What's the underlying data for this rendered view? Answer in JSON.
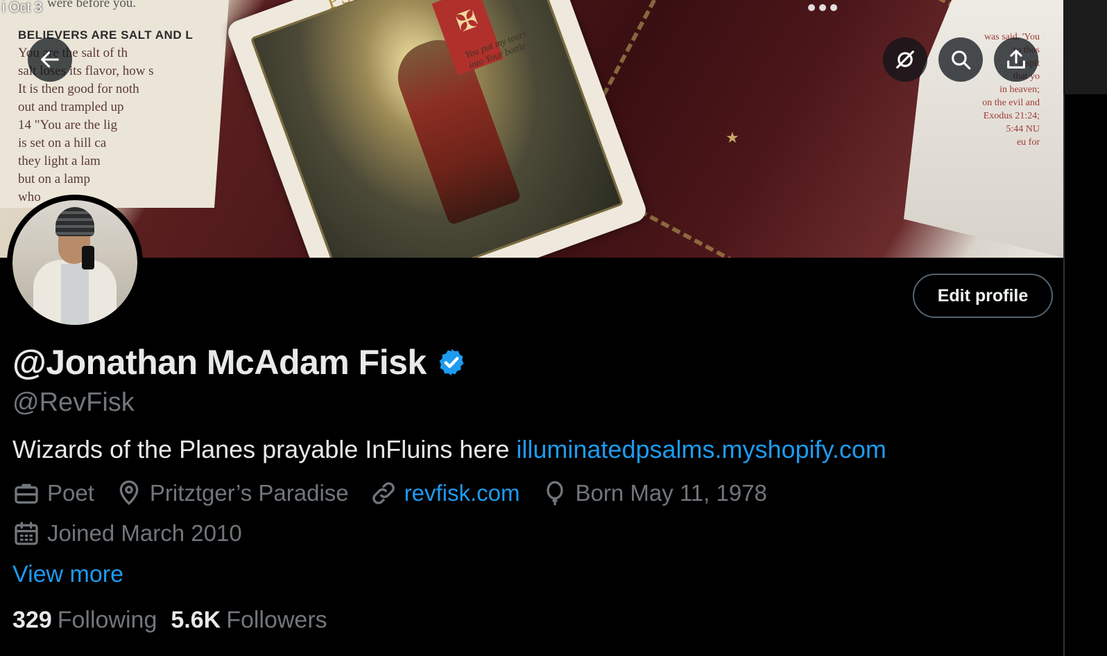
{
  "status_bar": {
    "date": "i Oct 3"
  },
  "banner": {
    "top_line": "were before you.",
    "scripture_heading": "BELIEVERS ARE SALT AND L",
    "scripture_lines": [
      "You are the salt of th",
      "salt loses its flavor, how s",
      "It is then good for noth",
      "out and trampled up",
      "14 \"You are the lig",
      "is set on a hill ca",
      "they light a lam",
      "but on a lamp",
      "who"
    ],
    "card_title": "PSALM",
    "card_verse": "You put my tears into Your bottle",
    "right_lines": [
      "was said, 'You",
      "to thos",
      "o spit",
      "that yo",
      "in heaven;",
      "on the evil and",
      "Exodus 21:24;",
      "5:44 NU",
      "eu for"
    ]
  },
  "header_buttons": {
    "back_label": "Back",
    "hide_reposts_label": "Hide reposts",
    "search_label": "Search",
    "share_label": "Share"
  },
  "profile": {
    "display_name": "@Jonathan McAdam Fisk",
    "handle": "@RevFisk",
    "bio_text": "Wizards of the Planes prayable InFluins here ",
    "bio_link": "illuminatedpsalms.myshopify.com",
    "edit_profile": "Edit profile",
    "profession": "Poet",
    "location": "Pritztger’s Paradise",
    "website": "revfisk.com",
    "birthday": "Born May 11, 1978",
    "joined": "Joined March 2010",
    "view_more": "View more",
    "following_count": "329",
    "following_label": "Following",
    "followers_count": "5.6K",
    "followers_label": "Followers"
  },
  "colors": {
    "background": "#000000",
    "text_primary": "#e7e9ea",
    "text_secondary": "#71767b",
    "link": "#1d9bf0",
    "verified": "#1d9bf0"
  }
}
